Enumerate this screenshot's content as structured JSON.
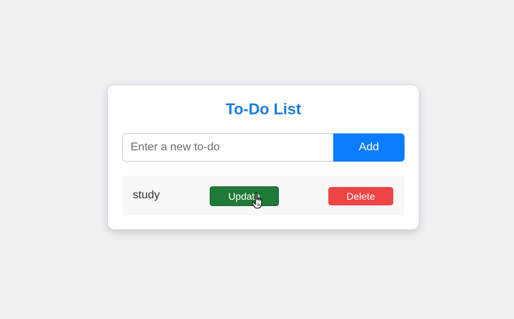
{
  "app": {
    "title": "To-Do List",
    "accent_color": "#1a7ce0"
  },
  "input": {
    "value": "",
    "placeholder": "Enter a new to-do"
  },
  "add_button": {
    "label": "Add",
    "color": "#0a7cff"
  },
  "todos": [
    {
      "text": "study",
      "update_label": "Update",
      "delete_label": "Delete",
      "update_color": "#1e7b36",
      "delete_color": "#ef4444"
    }
  ],
  "cursor": {
    "icon": "hand-pointer-icon"
  }
}
